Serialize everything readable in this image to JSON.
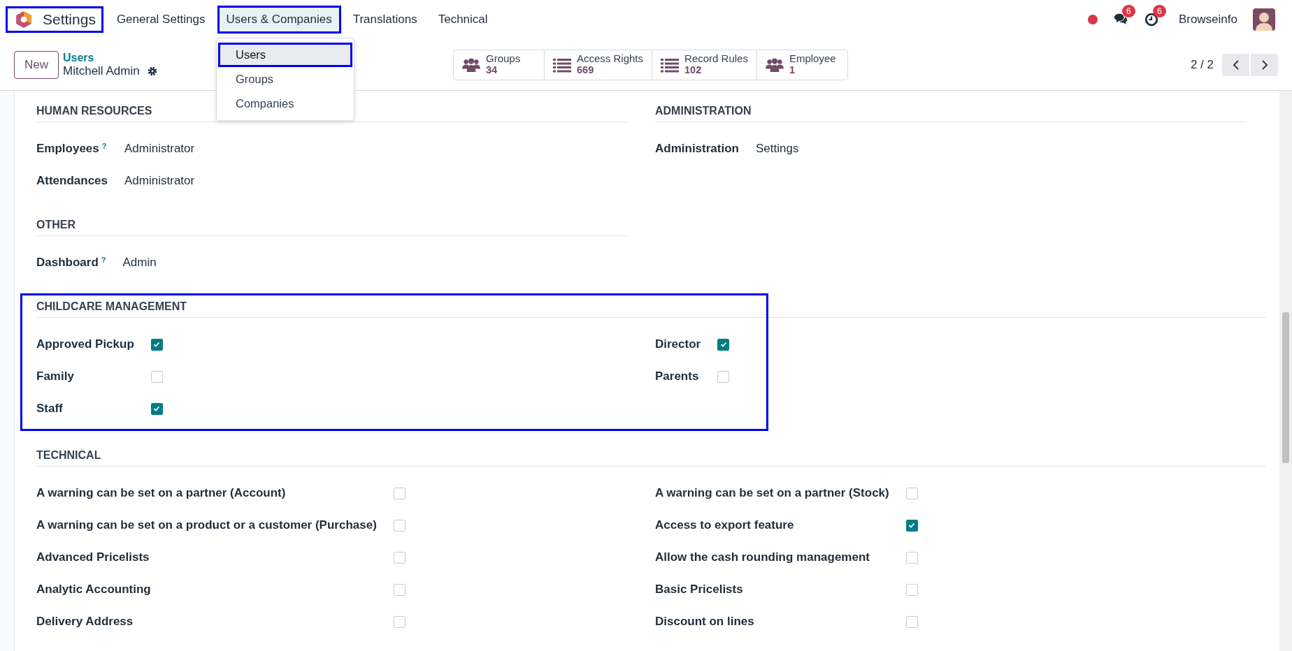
{
  "app": {
    "name": "Settings",
    "highlighted": true
  },
  "menu": [
    {
      "label": "General Settings",
      "selected": false,
      "highlighted": false
    },
    {
      "label": "Users & Companies",
      "selected": true,
      "highlighted": true
    },
    {
      "label": "Translations",
      "selected": false,
      "highlighted": false
    },
    {
      "label": "Technical",
      "selected": false,
      "highlighted": false
    }
  ],
  "dropdown": [
    {
      "label": "Users",
      "selected": true,
      "highlighted": true
    },
    {
      "label": "Groups",
      "selected": false,
      "highlighted": false
    },
    {
      "label": "Companies",
      "selected": false,
      "highlighted": false
    }
  ],
  "systray": {
    "messages_badge": "6",
    "activities_badge": "6",
    "user": "Browseinfo"
  },
  "control_panel": {
    "new_button": "New",
    "breadcrumb_parent": "Users",
    "breadcrumb_current": "Mitchell Admin",
    "pager": "2 / 2"
  },
  "stat_buttons": [
    {
      "kind": "people",
      "label": "Groups",
      "value": "34"
    },
    {
      "kind": "list",
      "label": "Access Rights",
      "value": "669"
    },
    {
      "kind": "list",
      "label": "Record Rules",
      "value": "102"
    },
    {
      "kind": "people",
      "label": "Employee",
      "value": "1"
    }
  ],
  "sections": [
    {
      "title": "HUMAN RESOURCES",
      "kind": "half",
      "highlighted": false,
      "fields": [
        {
          "kind": "text",
          "label": "Employees",
          "help": "?",
          "value": "Administrator"
        },
        {
          "kind": "text",
          "label": "Attendances",
          "value": "Administrator"
        }
      ]
    },
    {
      "title": "ADMINISTRATION",
      "kind": "half",
      "highlighted": false,
      "fields": [
        {
          "kind": "text",
          "label": "Administration",
          "value": "Settings"
        }
      ]
    },
    {
      "title": "OTHER",
      "kind": "half",
      "highlighted": false,
      "fields": [
        {
          "kind": "text",
          "label": "Dashboard",
          "help": "?",
          "value": "Admin"
        }
      ]
    },
    {
      "title": "CHILDCARE MANAGEMENT",
      "kind": "full",
      "highlighted": true,
      "fields": [
        {
          "kind": "checkbox",
          "label": "Approved Pickup",
          "checked": true
        },
        {
          "kind": "checkbox",
          "label": "Director",
          "checked": true
        },
        {
          "kind": "checkbox",
          "label": "Family",
          "checked": false
        },
        {
          "kind": "checkbox",
          "label": "Parents",
          "checked": false
        },
        {
          "kind": "checkbox",
          "label": "Staff",
          "checked": true
        }
      ]
    },
    {
      "title": "TECHNICAL",
      "kind": "full",
      "highlighted": false,
      "fields": [
        {
          "kind": "checkbox",
          "label": "A warning can be set on a partner (Account)",
          "checked": false
        },
        {
          "kind": "checkbox",
          "label": "A warning can be set on a partner (Stock)",
          "checked": false
        },
        {
          "kind": "checkbox",
          "label": "A warning can be set on a product or a customer (Purchase)",
          "checked": false
        },
        {
          "kind": "checkbox",
          "label": "Access to export feature",
          "checked": true
        },
        {
          "kind": "checkbox",
          "label": "Advanced Pricelists",
          "checked": false
        },
        {
          "kind": "checkbox",
          "label": "Allow the cash rounding management",
          "checked": false
        },
        {
          "kind": "checkbox",
          "label": "Analytic Accounting",
          "checked": false
        },
        {
          "kind": "checkbox",
          "label": "Basic Pricelists",
          "checked": false
        },
        {
          "kind": "checkbox",
          "label": "Delivery Address",
          "checked": false
        },
        {
          "kind": "checkbox",
          "label": "Discount on lines",
          "checked": false
        }
      ]
    }
  ]
}
